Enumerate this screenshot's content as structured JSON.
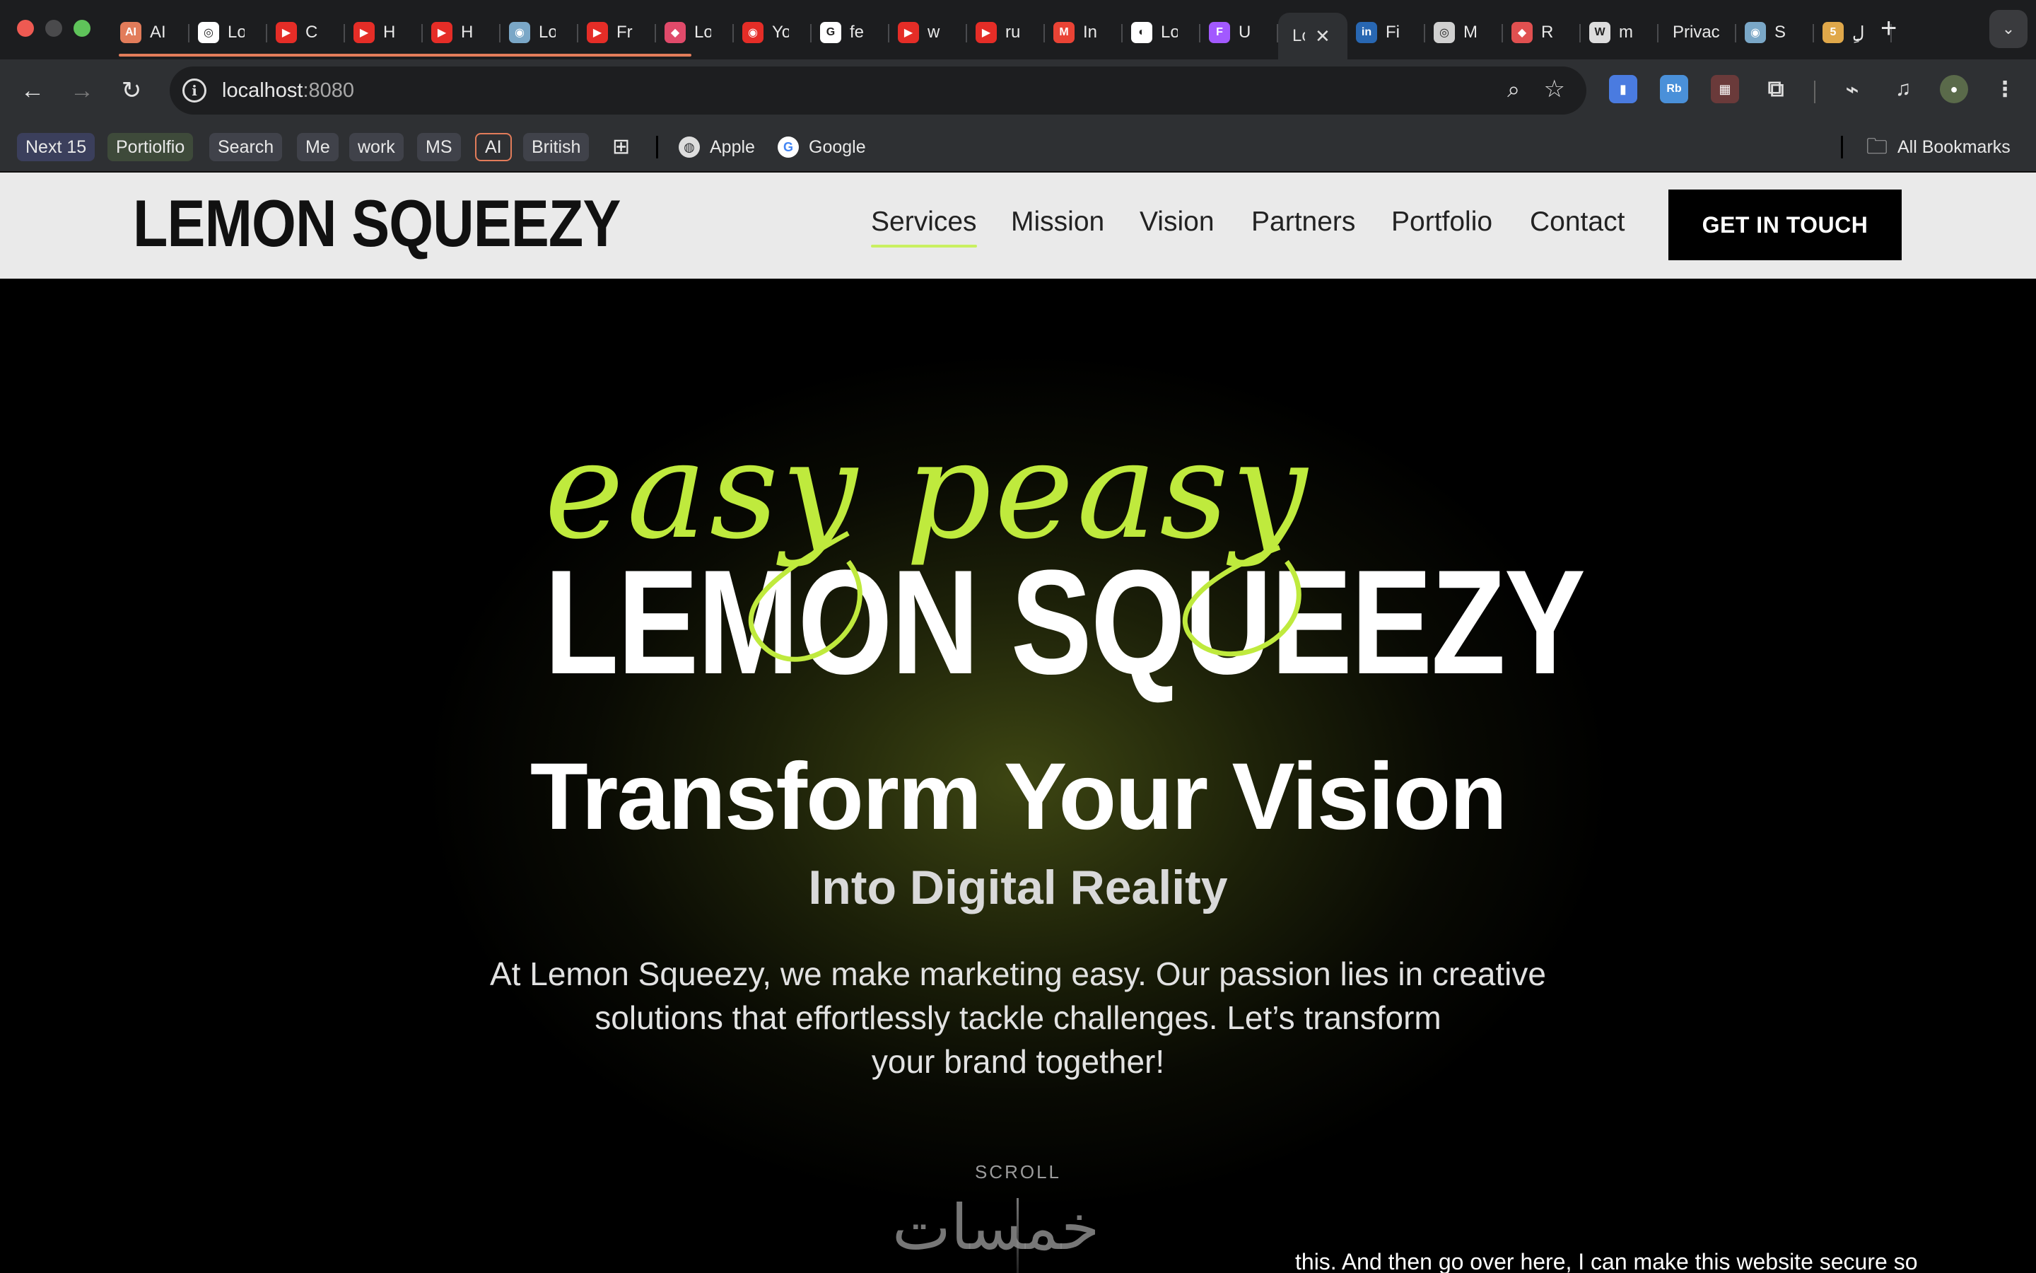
{
  "browser": {
    "tabs": [
      {
        "label": "AI",
        "color": "#e27c5a",
        "glyph": "AI",
        "icon": "ai-icon"
      },
      {
        "label": "Lo",
        "color": "#ffffff",
        "glyph": "◎",
        "icon": "openai-icon"
      },
      {
        "label": "C",
        "color": "#e52d27",
        "glyph": "▶",
        "icon": "youtube-icon"
      },
      {
        "label": "H",
        "color": "#e52d27",
        "glyph": "▶",
        "icon": "youtube-icon"
      },
      {
        "label": "H",
        "color": "#e52d27",
        "glyph": "▶",
        "icon": "youtube-icon"
      },
      {
        "label": "Lo",
        "color": "#7aa7c7",
        "glyph": "◉",
        "icon": "globe-icon"
      },
      {
        "label": "Fr",
        "color": "#e52d27",
        "glyph": "▶",
        "icon": "youtube-icon"
      },
      {
        "label": "Lo",
        "color": "#e04a6a",
        "glyph": "◆",
        "icon": "bookmark-shape-icon"
      },
      {
        "label": "Yo",
        "color": "#e52d27",
        "glyph": "◉",
        "icon": "youtube-music-icon"
      },
      {
        "label": "fe",
        "color": "#ffffff",
        "glyph": "G",
        "icon": "google-icon"
      },
      {
        "label": "w",
        "color": "#e52d27",
        "glyph": "▶",
        "icon": "youtube-icon"
      },
      {
        "label": "ru",
        "color": "#e52d27",
        "glyph": "▶",
        "icon": "youtube-icon"
      },
      {
        "label": "In",
        "color": "#ea4335",
        "glyph": "M",
        "icon": "gmail-icon"
      },
      {
        "label": "Lo",
        "color": "#ffffff",
        "glyph": "◐",
        "icon": "github-icon"
      },
      {
        "label": "U",
        "color": "#a259ff",
        "glyph": "F",
        "icon": "figma-icon"
      },
      {
        "label": "Lo",
        "color": "",
        "glyph": "",
        "icon": "",
        "active": true
      },
      {
        "label": "Fi",
        "color": "#2867b2",
        "glyph": "in",
        "icon": "linkedin-icon"
      },
      {
        "label": "M",
        "color": "#d0d0d0",
        "glyph": "◎",
        "icon": "app-icon"
      },
      {
        "label": "R",
        "color": "#e05050",
        "glyph": "◆",
        "icon": "pen-icon"
      },
      {
        "label": "m",
        "color": "#dddddd",
        "glyph": "W",
        "icon": "wordpress-icon"
      },
      {
        "label": "Privac",
        "color": "",
        "glyph": "",
        "icon": ""
      },
      {
        "label": "S",
        "color": "#7aa7c7",
        "glyph": "◉",
        "icon": "globe-icon"
      },
      {
        "label": "ِِل",
        "color": "#e0a84a",
        "glyph": "5",
        "icon": "app-five-icon"
      }
    ],
    "new_tab": "+",
    "tab_list": "⌄",
    "url_host": "localhost",
    "url_port": ":8080",
    "bookmarks": [
      "Next 15",
      "Portiolfio",
      "Search",
      "Me",
      "work",
      "MS",
      "AI",
      "British"
    ],
    "bookmark_colors": {
      "Next 15": "#3b3f5c",
      "Portiolfio": "#3e4a3a",
      "Search": "#40424a",
      "Me": "#40424a",
      "work": "#40424a",
      "MS": "#40424a",
      "AI": "#2e3033",
      "British": "#40424a"
    },
    "bookmark_links": [
      {
        "label": "Apple",
        "icon": "apple-globe-icon"
      },
      {
        "label": "Google",
        "icon": "google-icon"
      }
    ],
    "all_bookmarks": "All Bookmarks"
  },
  "site": {
    "brand": "LEMON SQUEEZY",
    "nav": [
      "Services",
      "Mission",
      "Vision",
      "Partners",
      "Portfolio",
      "Contact"
    ],
    "active_nav": "Services",
    "cta": "GET IN TOUCH",
    "hero": {
      "script_text": "easy peasy",
      "logo_text": "LEMON SQUEEZY",
      "headline": "Transform Your Vision",
      "subheadline": "Into Digital Reality",
      "intro_line1": "At Lemon Squeezy, we make marketing easy. Our passion lies in creative",
      "intro_line2": "solutions that effortlessly tackle challenges. Let’s transform",
      "intro_line3": "your brand together!",
      "scroll_label": "SCROLL",
      "accent_color": "#bfea3d"
    },
    "watermark": "خمسات",
    "caption": "this. And then go over here, I can make this website secure so"
  }
}
